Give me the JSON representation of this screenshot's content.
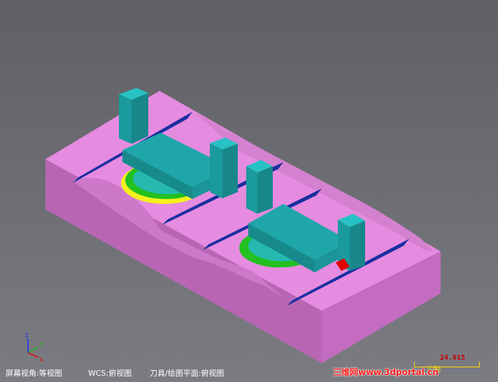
{
  "status_bar": {
    "screen_view": "屏幕视角:等视图",
    "wcs": "WCS:俯视图",
    "tool_plane": "刀具/绘图平面:俯视图"
  },
  "scale": {
    "value": "24.015",
    "unit": "公制"
  },
  "watermark": "三维网www.3dportal.cn",
  "axes": {
    "z": "Z",
    "y": "Y",
    "x": "X"
  },
  "colors": {
    "background": "#6a6b70",
    "block": "#e58be0",
    "fixture": "#1fa6a8",
    "slot": "#1a2fa0",
    "toolpath_green": "#22c020",
    "toolpath_yellow": "#f4f01e",
    "accent_red": "#e00000"
  }
}
